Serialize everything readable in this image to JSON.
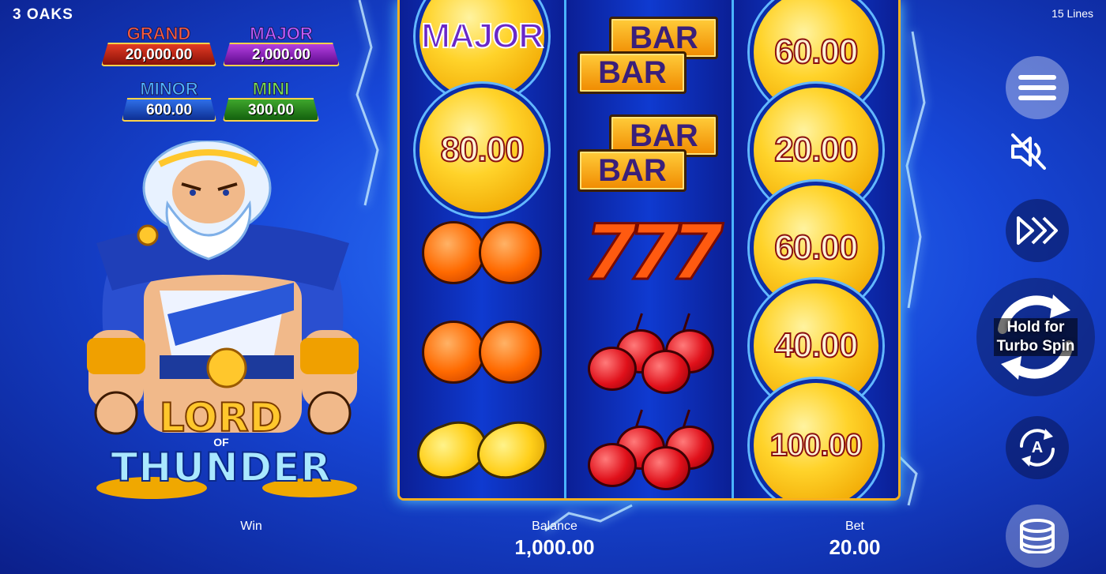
{
  "brand": "3 OAKS",
  "lines_label": "15 Lines",
  "jackpots": {
    "grand": {
      "label": "GRAND",
      "value": "20,000.00"
    },
    "major": {
      "label": "MAJOR",
      "value": "2,000.00"
    },
    "minor": {
      "label": "MINOR",
      "value": "600.00"
    },
    "mini": {
      "label": "MINI",
      "value": "300.00"
    }
  },
  "logo": {
    "line1": "LORD",
    "line2": "OF",
    "line3": "THUNDER"
  },
  "reels": {
    "reel1": {
      "major_coin": "MAJOR",
      "coin2": "80.00",
      "symbols": [
        "oranges",
        "oranges",
        "lemons"
      ]
    },
    "reel2": {
      "bar_label": "BAR",
      "sevens": "777",
      "symbols": [
        "double-bar",
        "double-bar",
        "sevens",
        "cherries",
        "cherries"
      ]
    },
    "reel3": {
      "coins": [
        "60.00",
        "20.00",
        "60.00",
        "40.00",
        "100.00"
      ]
    }
  },
  "controls": {
    "spin_hint_line1": "Hold for",
    "spin_hint_line2": "Turbo Spin",
    "auto_letter": "A"
  },
  "stats": {
    "win_label": "Win",
    "win_value": "",
    "balance_label": "Balance",
    "balance_value": "1,000.00",
    "bet_label": "Bet",
    "bet_value": "20.00"
  },
  "colors": {
    "accent": "#f5b020",
    "background": "#1747d8",
    "coin": "#ffd32a"
  }
}
